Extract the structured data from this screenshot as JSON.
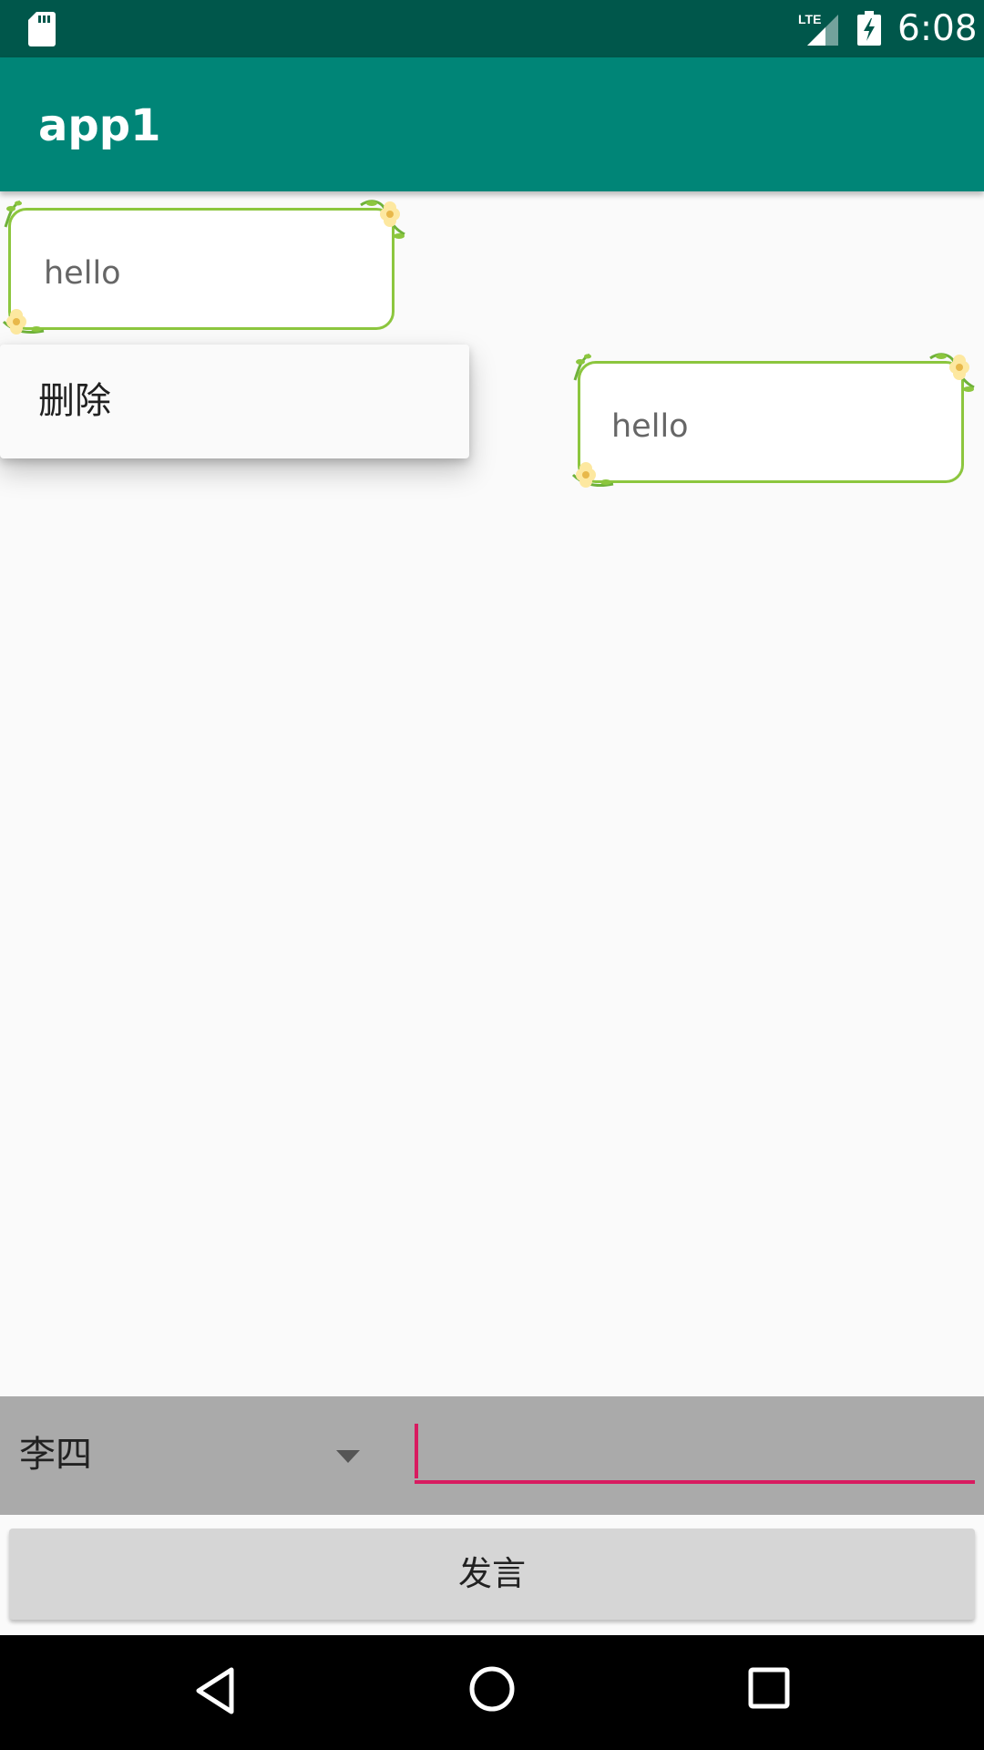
{
  "status_bar": {
    "time": "6:08",
    "network": "LTE",
    "icons": [
      "sd-card-icon",
      "lte-signal-icon",
      "battery-charging-icon"
    ]
  },
  "app_bar": {
    "title": "app1"
  },
  "messages": [
    {
      "text": "hello",
      "side": "left"
    },
    {
      "text": "hello",
      "side": "right"
    }
  ],
  "context_menu": {
    "items": [
      "删除"
    ]
  },
  "input_bar": {
    "speaker_selected": "李四",
    "message_value": "",
    "accent_color": "#d81b60"
  },
  "send_button": {
    "label": "发言"
  },
  "nav_bar": {
    "icons": [
      "back-icon",
      "home-icon",
      "recents-icon"
    ]
  },
  "colors": {
    "status_bar": "#00574b",
    "app_bar": "#008577",
    "bubble_border": "#8cc63e",
    "input_bar_bg": "#aaaaaa",
    "button_bg": "#d6d6d6"
  }
}
